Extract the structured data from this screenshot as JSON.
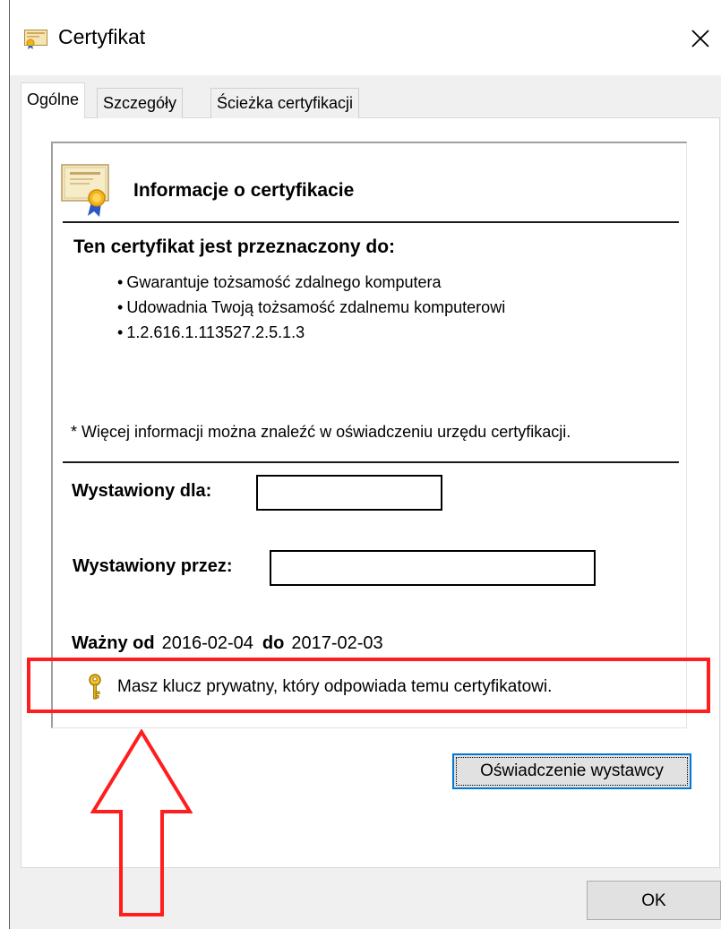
{
  "window": {
    "title": "Certyfikat",
    "title_icon": "certificate-icon",
    "close_icon": "close-icon"
  },
  "tabs": [
    {
      "label": "Ogólne",
      "active": true
    },
    {
      "label": "Szczegóły",
      "active": false
    },
    {
      "label": "Ścieżka certyfikacji",
      "active": false
    }
  ],
  "general": {
    "info_title": "Informacje o certyfikacie",
    "purpose_heading": "Ten certyfikat jest przeznaczony do:",
    "purposes": [
      "Gwarantuje tożsamość zdalnego komputera",
      "Udowadnia Twoją tożsamość zdalnemu komputerowi",
      "1.2.616.1.113527.2.5.1.3"
    ],
    "footnote": "* Więcej informacji można znaleźć w oświadczeniu urzędu certyfikacji.",
    "issued_to_label": "Wystawiony dla:",
    "issued_to_value": "",
    "issued_by_label": "Wystawiony przez:",
    "issued_by_value": "",
    "valid_from_label": "Ważny od",
    "valid_from": "2016-02-04",
    "valid_to_label": "do",
    "valid_to": "2017-02-03",
    "private_key_note": "Masz klucz prywatny, który odpowiada temu certyfikatowi.",
    "private_key_icon": "key-icon"
  },
  "buttons": {
    "issuer_statement": "Oświadczenie wystawcy",
    "ok": "OK"
  },
  "annotation": {
    "highlight_color": "#ff1e1e",
    "arrow_icon": "up-arrow-icon"
  },
  "colors": {
    "focus_border": "#0078d7",
    "panel_bg": "#ffffff",
    "window_bg": "#f0f0f0"
  }
}
